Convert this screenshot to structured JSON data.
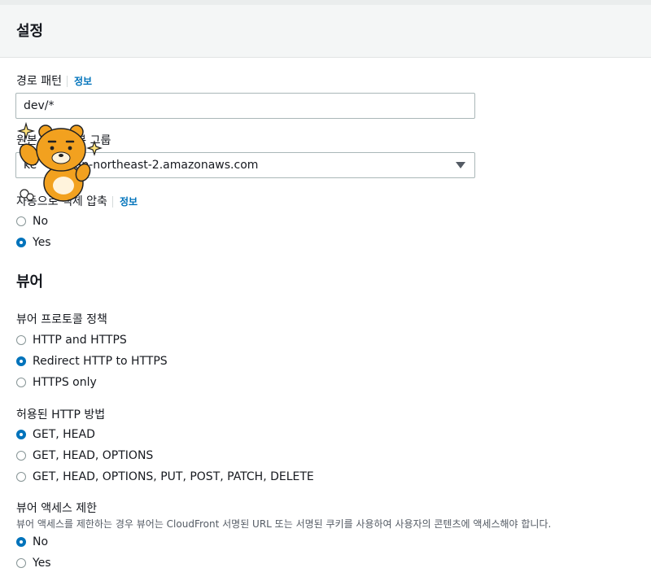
{
  "settings": {
    "title": "설정",
    "path_pattern": {
      "label": "경로 패턴",
      "info": "정보",
      "value": "dev/*"
    },
    "origin_group": {
      "label": "원본 또는 원본 그룹",
      "value": "ke",
      "value_suffix": ".ap-northeast-2.amazonaws.com"
    },
    "compress": {
      "label": "자동으로 객체 압축",
      "info": "정보",
      "options": [
        {
          "label": "No",
          "checked": false
        },
        {
          "label": "Yes",
          "checked": true
        }
      ]
    }
  },
  "viewer": {
    "title": "뷰어",
    "protocol_policy": {
      "label": "뷰어 프로토콜 정책",
      "options": [
        {
          "label": "HTTP and HTTPS",
          "checked": false
        },
        {
          "label": "Redirect HTTP to HTTPS",
          "checked": true
        },
        {
          "label": "HTTPS only",
          "checked": false
        }
      ]
    },
    "allowed_methods": {
      "label": "허용된 HTTP 방법",
      "options": [
        {
          "label": "GET, HEAD",
          "checked": true
        },
        {
          "label": "GET, HEAD, OPTIONS",
          "checked": false
        },
        {
          "label": "GET, HEAD, OPTIONS, PUT, POST, PATCH, DELETE",
          "checked": false
        }
      ]
    },
    "restrict_access": {
      "label": "뷰어 액세스 제한",
      "description": "뷰어 액세스를 제한하는 경우 뷰어는 CloudFront 서명된 URL 또는 서명된 쿠키를 사용하여 사용자의 콘텐츠에 액세스해야 합니다.",
      "options": [
        {
          "label": "No",
          "checked": true
        },
        {
          "label": "Yes",
          "checked": false
        }
      ]
    }
  },
  "colors": {
    "accent": "#0073bb",
    "header_bg": "#f4f6f6",
    "mascot": "#f2a11f"
  }
}
